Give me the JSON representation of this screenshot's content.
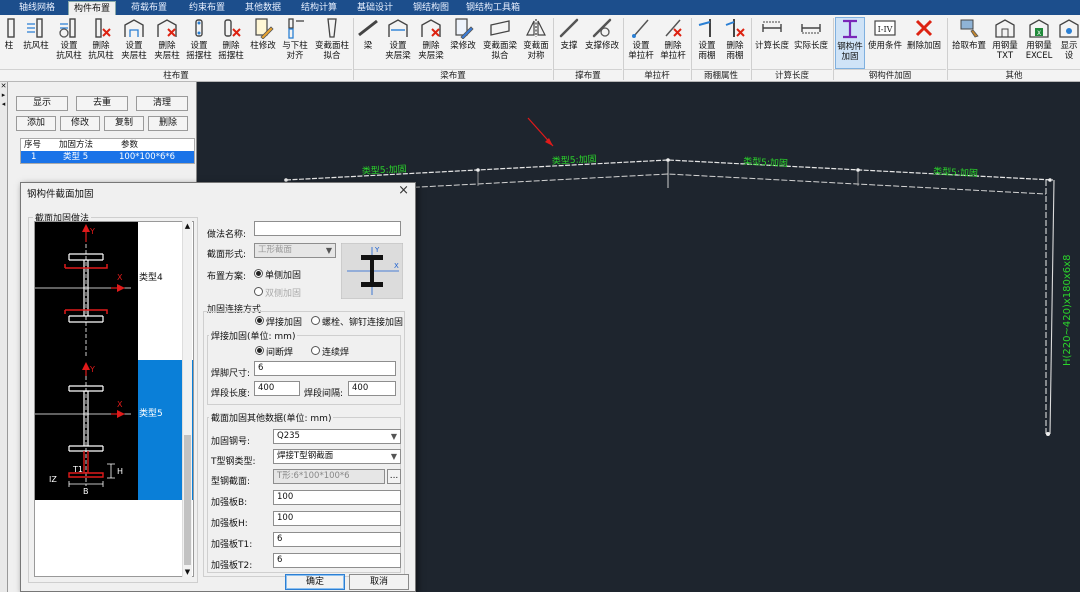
{
  "tabs": [
    "轴线网格",
    "构件布置",
    "荷载布置",
    "约束布置",
    "其他数据",
    "结构计算",
    "基础设计",
    "钢结构图",
    "钢结构工具箱"
  ],
  "active_tab": "构件布置",
  "ribbon": {
    "column_group": {
      "label": "柱布置",
      "buttons": [
        "柱",
        "抗风柱",
        "设置\n抗风柱",
        "删除\n抗风柱",
        "设置\n夹层柱",
        "删除\n夹层柱",
        "设置\n摇摆柱",
        "删除\n摇摆柱",
        "柱修改",
        "与下柱\n对齐",
        "变截面柱\n拟合"
      ]
    },
    "beam_group": {
      "label": "梁布置",
      "buttons": [
        "梁",
        "设置\n夹层梁",
        "删除\n夹层梁",
        "梁修改",
        "变截面梁\n拟合",
        "变截面\n对称"
      ]
    },
    "brace_group": {
      "label": "撑布置",
      "buttons": [
        "支撑",
        "支撑修改"
      ]
    },
    "tie_group": {
      "label": "单拉杆",
      "buttons": [
        "设置\n单拉杆",
        "删除\n单拉杆"
      ]
    },
    "canopy_group": {
      "label": "雨棚属性",
      "buttons": [
        "设置\n雨棚",
        "删除\n雨棚"
      ]
    },
    "length_group": {
      "label": "计算长度",
      "buttons": [
        "计算长度",
        "实际长度"
      ]
    },
    "reinforce_group": {
      "label": "钢构件加固",
      "buttons": [
        "钢构件\n加固",
        "使用条件",
        "删除加固"
      ]
    },
    "other_group": {
      "label": "其他",
      "buttons": [
        "拾取布置",
        "用钢量\nTXT",
        "用钢量\nEXCEL",
        "显示设"
      ]
    }
  },
  "left_panel": {
    "buttons": [
      "显示",
      "去重",
      "清理",
      "添加",
      "修改",
      "复制",
      "删除"
    ],
    "table": {
      "headers": [
        "序号",
        "加固方法",
        "参数"
      ],
      "rows": [
        [
          "1",
          "类型 5",
          "100*100*6*6"
        ]
      ]
    }
  },
  "canvas": {
    "beam_labels": [
      "类型5:加固",
      "类型5:加固",
      "类型5:加固",
      "类型5:加固"
    ],
    "column_label": "H(220~420)x180x6x8"
  },
  "dialog": {
    "title": "钢构件截面加固",
    "close": "×",
    "list_label": "截面加固做法",
    "types": [
      "类型4",
      "类型5"
    ],
    "selected_type": "类型5",
    "form": {
      "name_label": "做法名称:",
      "name_value": "",
      "section_form_label": "截面形式:",
      "section_form_value": "工形截面",
      "scheme_label": "布置方案:",
      "scheme_options": [
        "单侧加固",
        "双侧加固"
      ],
      "scheme_selected": "单侧加固",
      "connect_title": "加固连接方式",
      "connect_options": [
        "焊接加固",
        "螺栓、铆钉连接加固"
      ],
      "connect_selected": "焊接加固",
      "weld_title": "焊接加固(单位: mm)",
      "weld_options": [
        "间断焊",
        "连续焊"
      ],
      "weld_selected": "间断焊",
      "weld_size_label": "焊脚尺寸:",
      "weld_size_value": "6",
      "weld_len_label": "焊段长度:",
      "weld_len_value": "400",
      "weld_gap_label": "焊段间隔:",
      "weld_gap_value": "400",
      "other_title": "截面加固其他数据(单位: mm)",
      "steel_label": "加固钢号:",
      "steel_value": "Q235",
      "tsteel_label": "T型钢类型:",
      "tsteel_value": "焊接T型钢截面",
      "profile_label": "型钢截面:",
      "profile_value": "T形:6*100*100*6",
      "profile_btn": "...",
      "b_label": "加强板B:",
      "b_value": "100",
      "h_label": "加强板H:",
      "h_value": "100",
      "t1_label": "加强板T1:",
      "t1_value": "6",
      "t2_label": "加强板T2:",
      "t2_value": "6"
    },
    "ok": "确定",
    "cancel": "取消",
    "diagram_labels": {
      "y": "Y",
      "x": "X",
      "t1": "T1",
      "h": "H",
      "b": "B",
      "iz": "IZ"
    }
  },
  "colors": {
    "tabbar": "#1c4e8c",
    "selection": "#1a73e8",
    "canvas": "#1e252e",
    "beam_label": "#2bd52b",
    "reinforce_red": "#e01a1a"
  }
}
